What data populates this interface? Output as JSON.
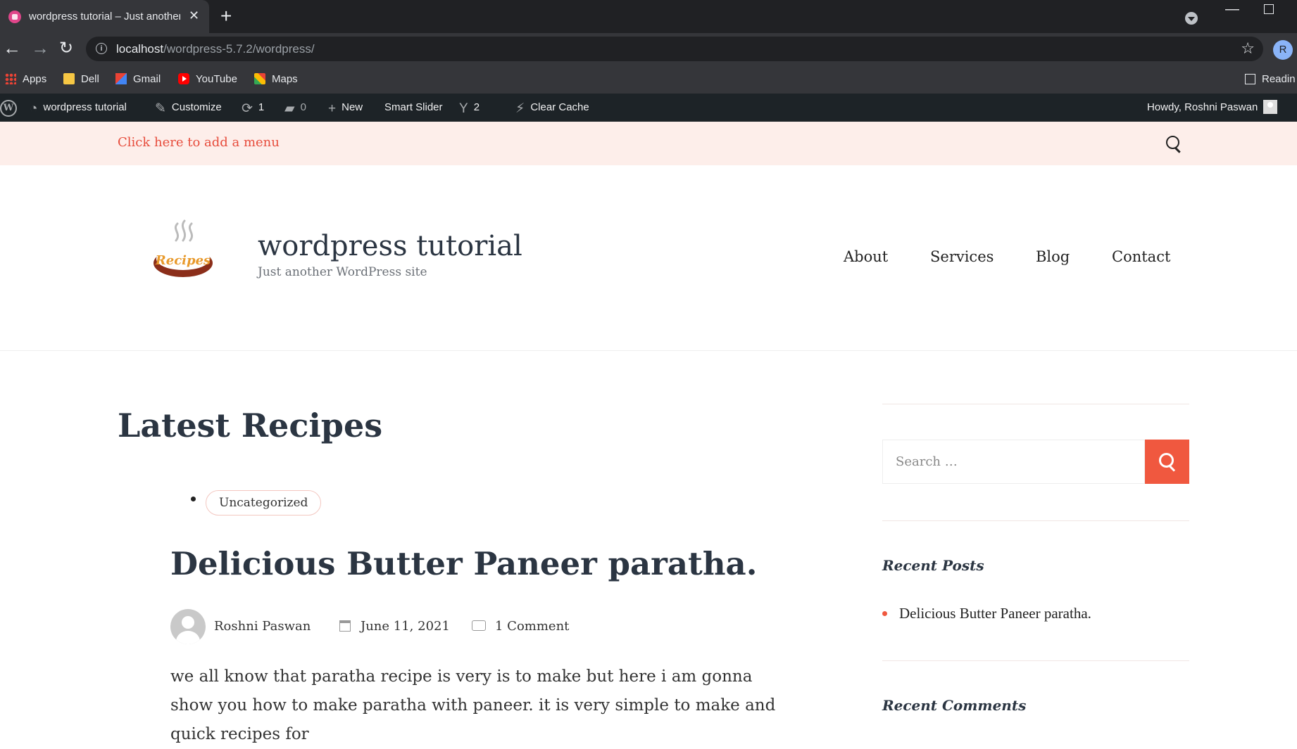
{
  "browser": {
    "tab_title": "wordpress tutorial – Just another WordPress site",
    "url_host": "localhost",
    "url_path": "/wordpress-5.7.2/wordpress/",
    "profile_initial": "R",
    "bookmarks": [
      "Apps",
      "Dell",
      "Gmail",
      "YouTube",
      "Maps"
    ],
    "reading_list": "Readin"
  },
  "admin_bar": {
    "site_name": "wordpress tutorial",
    "customize": "Customize",
    "updates_count": "1",
    "comments_count": "0",
    "new_label": "New",
    "smart_slider": "Smart Slider",
    "yoast_count": "2",
    "clear_cache": "Clear Cache",
    "howdy": "Howdy, Roshni Paswan"
  },
  "topbar": {
    "add_menu": "Click here to add a menu"
  },
  "header": {
    "logo_text": "Recipes",
    "site_title": "wordpress tutorial",
    "tagline": "Just another WordPress site",
    "nav": [
      "About",
      "Services",
      "Blog",
      "Contact"
    ]
  },
  "main": {
    "section_title": "Latest Recipes",
    "category": "Uncategorized",
    "post": {
      "title": "Delicious Butter Paneer paratha.",
      "author": "Roshni Paswan",
      "date": "June 11, 2021",
      "comments": "1 Comment",
      "excerpt": "we all know that paratha recipe is very is to make but here i am gonna show you how to make paratha with paneer. it is very simple to make and quick recipes for"
    }
  },
  "sidebar": {
    "search_placeholder": "Search …",
    "recent_posts_heading": "Recent Posts",
    "recent_posts": [
      "Delicious Butter Paneer paratha."
    ],
    "recent_comments_heading": "Recent Comments"
  },
  "colors": {
    "accent": "#f0583f",
    "topbar_bg": "#fdeeea",
    "heading": "#2b3542",
    "admin_bar_bg": "#1d2327"
  }
}
